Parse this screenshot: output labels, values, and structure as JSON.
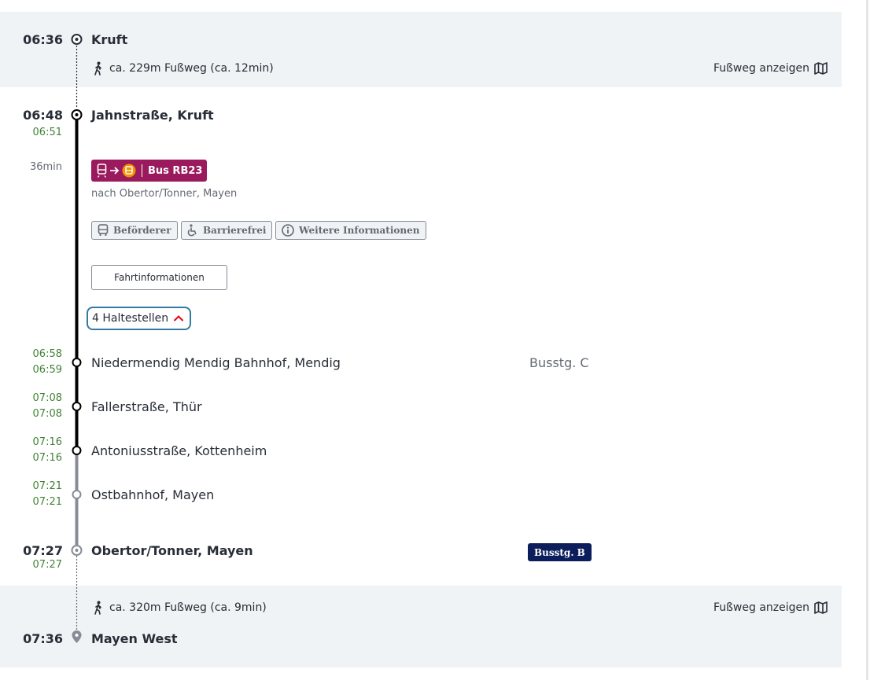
{
  "colors": {
    "band": "#f0f3f5",
    "line_badge": "#9a1a5d",
    "realtime": "#408335",
    "platform_badge": "#0c1d5c",
    "focus_border": "#3479a2",
    "chevron": "#ec0016"
  },
  "start": {
    "time": "06:36",
    "name": "Kruft"
  },
  "walk1": {
    "icon": "walking-person-icon",
    "text": "ca. 229m Fußweg (ca. 12min)",
    "link": "Fußweg anzeigen",
    "link_icon": "map-icon"
  },
  "departure": {
    "time": "06:48",
    "realtime": "06:51",
    "name": "Jahnstraße, Kruft"
  },
  "journey": {
    "duration": "36min",
    "line": "Bus RB23",
    "badge_icons": [
      "train-icon",
      "arrow-right-icon",
      "bus-icon"
    ],
    "direction": "nach Obertor/Tonner, Mayen",
    "chips": [
      {
        "label": "Beförderer",
        "icon": "bus-icon"
      },
      {
        "label": "Barrierefrei",
        "icon": "wheelchair-icon"
      },
      {
        "label": "Weitere Informationen",
        "icon": "info-icon"
      }
    ],
    "trip_info_button": "Fahrtinformationen",
    "stops_toggle": "4 Haltestellen"
  },
  "intermediate_stops": [
    {
      "arr": "06:58",
      "dep": "06:59",
      "name": "Niedermendig Mendig Bahnhof, Mendig",
      "platform": "Busstg. C"
    },
    {
      "arr": "07:08",
      "dep": "07:08",
      "name": "Fallerstraße, Thür",
      "platform": ""
    },
    {
      "arr": "07:16",
      "dep": "07:16",
      "name": "Antoniusstraße, Kottenheim",
      "platform": ""
    },
    {
      "arr": "07:21",
      "dep": "07:21",
      "name": "Ostbahnhof, Mayen",
      "platform": ""
    }
  ],
  "arrival": {
    "time": "07:27",
    "realtime": "07:27",
    "name": "Obertor/Tonner, Mayen",
    "platform": "Busstg. B"
  },
  "walk2": {
    "icon": "walking-person-icon",
    "text": "ca. 320m Fußweg (ca. 9min)",
    "link": "Fußweg anzeigen",
    "link_icon": "map-icon"
  },
  "destination": {
    "time": "07:36",
    "name": "Mayen West",
    "icon": "location-pin-icon"
  }
}
